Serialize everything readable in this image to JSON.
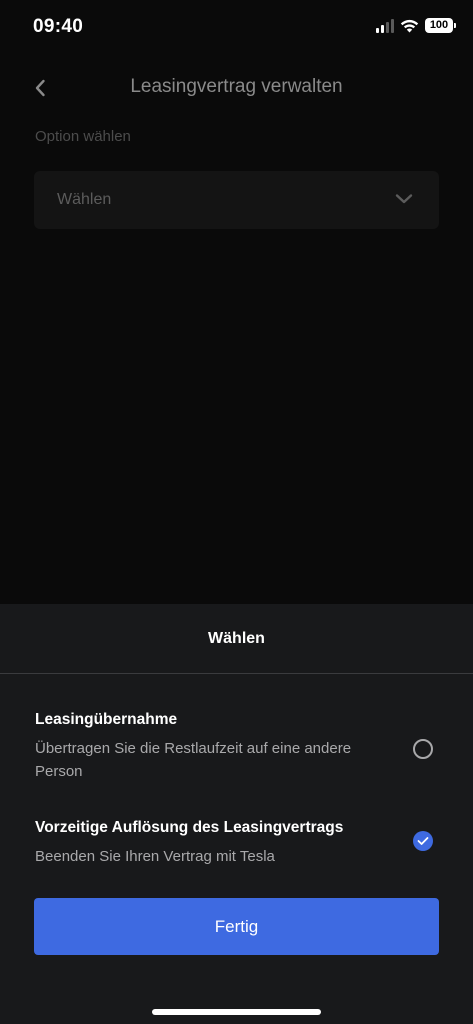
{
  "status_bar": {
    "time": "09:40",
    "battery": "100",
    "icons": [
      "cellular-signal-icon",
      "wifi-icon",
      "battery-icon"
    ]
  },
  "header": {
    "back_icon": "chevron-left-icon",
    "title": "Leasingvertrag verwalten"
  },
  "form": {
    "option_label": "Option wählen",
    "select_value": "Wählen",
    "select_icon": "chevron-down-icon"
  },
  "sheet": {
    "title": "Wählen",
    "options": [
      {
        "title": "Leasingübernahme",
        "description": "Übertragen Sie die Restlaufzeit auf eine andere Person",
        "selected": false
      },
      {
        "title": "Vorzeitige Auflösung des Leasingvertrags",
        "description": "Beenden Sie Ihren Vertrag mit Tesla",
        "selected": true
      }
    ],
    "done_label": "Fertig"
  },
  "colors": {
    "accent": "#3e6ae1",
    "sheet_background": "#18191b",
    "page_background": "#0a0a0a"
  }
}
